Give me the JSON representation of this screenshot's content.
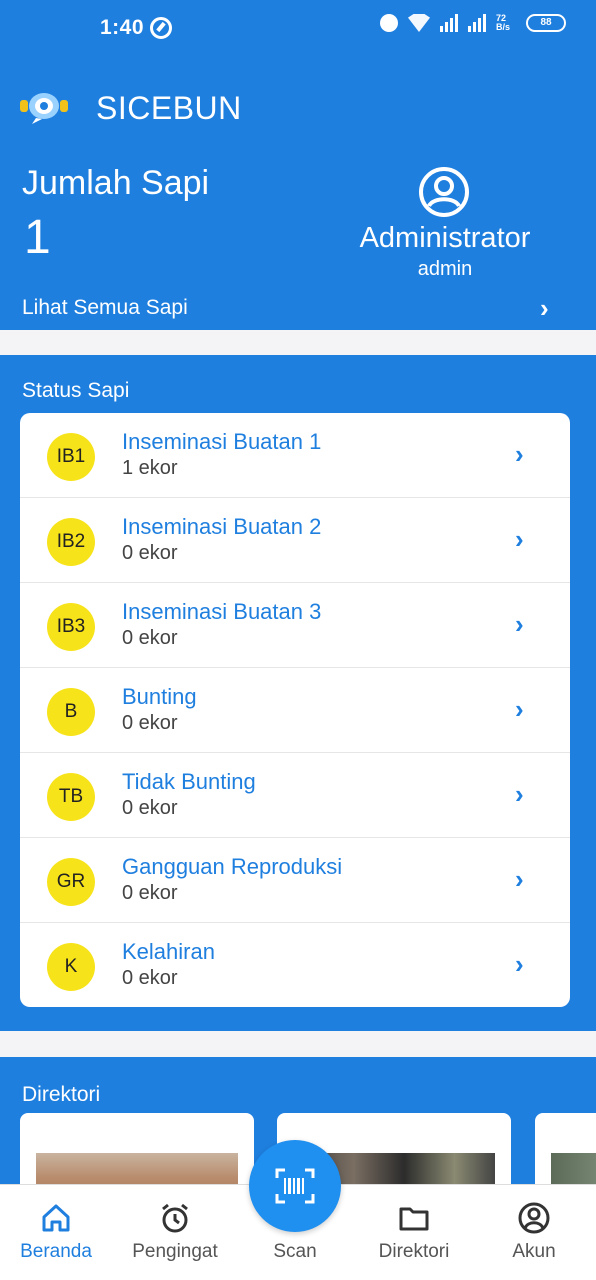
{
  "status_bar": {
    "time": "1:40",
    "network": "72 B/s",
    "battery": "88"
  },
  "header": {
    "app_title": "SICEBUN"
  },
  "summary": {
    "count_label": "Jumlah Sapi",
    "count_value": "1",
    "see_all_label": "Lihat Semua Sapi",
    "user_name": "Administrator",
    "user_role": "admin"
  },
  "status": {
    "title": "Status Sapi",
    "items": [
      {
        "code": "IB1",
        "label": "Inseminasi Buatan 1",
        "count": "1 ekor"
      },
      {
        "code": "IB2",
        "label": "Inseminasi Buatan 2",
        "count": "0 ekor"
      },
      {
        "code": "IB3",
        "label": "Inseminasi Buatan 3",
        "count": "0 ekor"
      },
      {
        "code": "B",
        "label": "Bunting",
        "count": "0 ekor"
      },
      {
        "code": "TB",
        "label": "Tidak Bunting",
        "count": "0 ekor"
      },
      {
        "code": "GR",
        "label": "Gangguan Reproduksi",
        "count": "0 ekor"
      },
      {
        "code": "K",
        "label": "Kelahiran",
        "count": "0 ekor"
      }
    ]
  },
  "directory": {
    "title": "Direktori"
  },
  "nav": {
    "items": [
      {
        "label": "Beranda",
        "icon": "home-icon"
      },
      {
        "label": "Pengingat",
        "icon": "alarm-clock-icon"
      },
      {
        "label": "Scan",
        "icon": "barcode-scan-icon"
      },
      {
        "label": "Direktori",
        "icon": "folder-icon"
      },
      {
        "label": "Akun",
        "icon": "account-icon"
      }
    ]
  },
  "colors": {
    "primary": "#1f7fdf",
    "badge": "#f7e31a"
  }
}
